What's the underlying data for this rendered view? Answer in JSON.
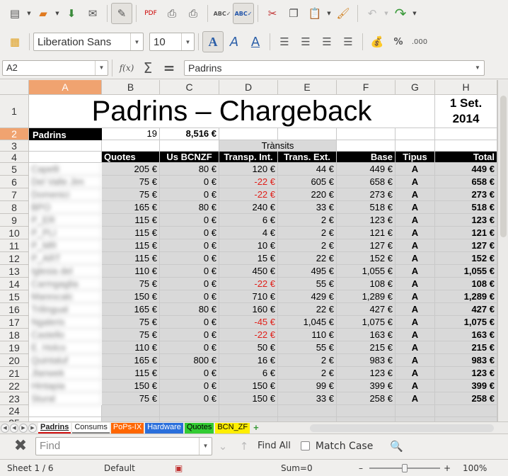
{
  "toolbar": {
    "row1": [
      "new-icon",
      "open-icon",
      "save-icon",
      "email-icon",
      "edit-mode-icon",
      "export-pdf-icon",
      "print-icon",
      "print-preview-icon",
      "spellcheck-icon",
      "autospellcheck-icon",
      "cut-icon",
      "copy-icon",
      "paste-icon",
      "clone-format-icon",
      "undo-icon",
      "redo-icon"
    ]
  },
  "format": {
    "font_name": "Liberation Sans",
    "font_size": "10",
    "percent_label": "%",
    "decimal_label": ".000"
  },
  "formula": {
    "cell_ref": "A2",
    "fx_label": "f(x)",
    "sum_label": "Σ",
    "equals_label": "=",
    "content": "Padrins"
  },
  "columns": [
    "A",
    "B",
    "C",
    "D",
    "E",
    "F",
    "G",
    "H"
  ],
  "rows": [
    "1",
    "2",
    "3",
    "4",
    "5",
    "6",
    "7",
    "8",
    "9",
    "10",
    "11",
    "12",
    "13",
    "14",
    "15",
    "16",
    "17",
    "18",
    "19",
    "20",
    "21",
    "22",
    "23",
    "24",
    "25"
  ],
  "sheet": {
    "title": "Padrins – Chargeback",
    "date": "1 Set. 2014",
    "r2": {
      "a": "Padrins",
      "b": "19",
      "c": "8,516 €"
    },
    "transits_label": "Trànsits",
    "headers": [
      "Quotes",
      "Us BCNZF",
      "Transp. Int.",
      "Trans. Ext.",
      "Base",
      "Tipus",
      "Total"
    ],
    "names": [
      "Capelli",
      "Del Valle Jim",
      "Domenici",
      "BPO",
      "P_ER",
      "P_PLI",
      "P_MR",
      "P_ART",
      "Iglesia del",
      "Carmgaglia",
      "Marescalc",
      "Trilingual",
      "Ngaleris",
      "Castello",
      "E. Holco",
      "Quintaluf",
      "Jlanwek",
      "Hintapia",
      "Stural"
    ],
    "data": [
      [
        "205 €",
        "80 €",
        "120 €",
        "44 €",
        "449 €",
        "A",
        "449 €"
      ],
      [
        "75 €",
        "0 €",
        "-22 €",
        "605 €",
        "658 €",
        "A",
        "658 €"
      ],
      [
        "75 €",
        "0 €",
        "-22 €",
        "220 €",
        "273 €",
        "A",
        "273 €"
      ],
      [
        "165 €",
        "80 €",
        "240 €",
        "33 €",
        "518 €",
        "A",
        "518 €"
      ],
      [
        "115 €",
        "0 €",
        "6 €",
        "2 €",
        "123 €",
        "A",
        "123 €"
      ],
      [
        "115 €",
        "0 €",
        "4 €",
        "2 €",
        "121 €",
        "A",
        "121 €"
      ],
      [
        "115 €",
        "0 €",
        "10 €",
        "2 €",
        "127 €",
        "A",
        "127 €"
      ],
      [
        "115 €",
        "0 €",
        "15 €",
        "22 €",
        "152 €",
        "A",
        "152 €"
      ],
      [
        "110 €",
        "0 €",
        "450 €",
        "495 €",
        "1,055 €",
        "A",
        "1,055 €"
      ],
      [
        "75 €",
        "0 €",
        "-22 €",
        "55 €",
        "108 €",
        "A",
        "108 €"
      ],
      [
        "150 €",
        "0 €",
        "710 €",
        "429 €",
        "1,289 €",
        "A",
        "1,289 €"
      ],
      [
        "165 €",
        "80 €",
        "160 €",
        "22 €",
        "427 €",
        "A",
        "427 €"
      ],
      [
        "75 €",
        "0 €",
        "-45 €",
        "1,045 €",
        "1,075 €",
        "A",
        "1,075 €"
      ],
      [
        "75 €",
        "0 €",
        "-22 €",
        "110 €",
        "163 €",
        "A",
        "163 €"
      ],
      [
        "110 €",
        "0 €",
        "50 €",
        "55 €",
        "215 €",
        "A",
        "215 €"
      ],
      [
        "165 €",
        "800 €",
        "16 €",
        "2 €",
        "983 €",
        "A",
        "983 €"
      ],
      [
        "115 €",
        "0 €",
        "6 €",
        "2 €",
        "123 €",
        "A",
        "123 €"
      ],
      [
        "150 €",
        "0 €",
        "150 €",
        "99 €",
        "399 €",
        "A",
        "399 €"
      ],
      [
        "75 €",
        "0 €",
        "150 €",
        "33 €",
        "258 €",
        "A",
        "258 €"
      ]
    ]
  },
  "tabs": [
    {
      "label": "Padrins",
      "color": "#ffffff",
      "border": "#d01010",
      "active": true
    },
    {
      "label": "Consums",
      "color": "#ffffff",
      "border": "#888888",
      "active": false
    },
    {
      "label": "PoPs-IX",
      "color": "#ff6600",
      "border": "#ff6600",
      "active": false
    },
    {
      "label": "Hardware",
      "color": "#2a6fdb",
      "border": "#2a6fdb",
      "active": false
    },
    {
      "label": "Quotes",
      "color": "#33cc33",
      "border": "#33cc33",
      "active": false
    },
    {
      "label": "BCN_ZF",
      "color": "#ffee00",
      "border": "#ffee00",
      "active": false
    }
  ],
  "find": {
    "placeholder": "Find",
    "find_all": "Find All",
    "match_case": "Match Case"
  },
  "status": {
    "sheet": "Sheet 1 / 6",
    "style": "Default",
    "sum": "Sum=0",
    "zoom": "100%"
  }
}
